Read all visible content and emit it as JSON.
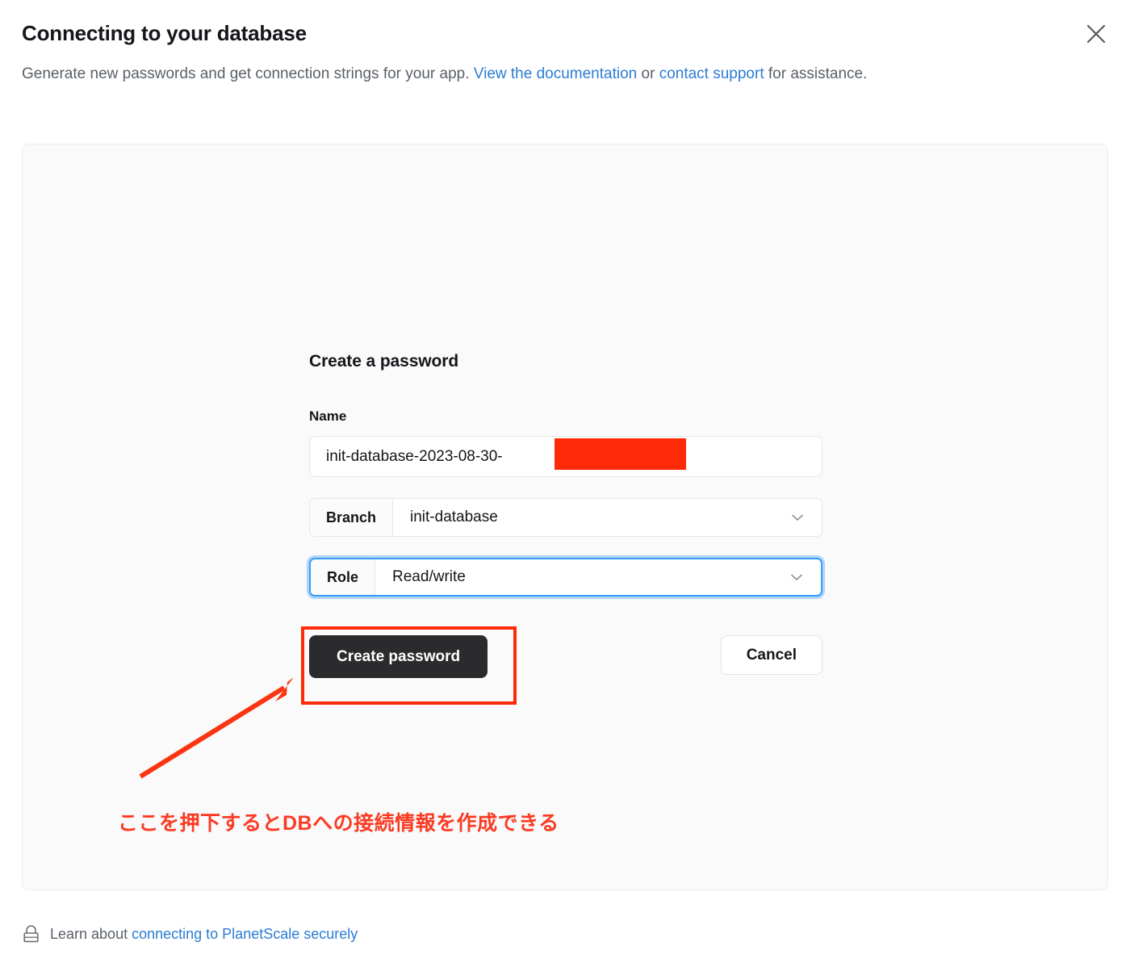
{
  "modal": {
    "title": "Connecting to your database",
    "subtitle_part1": "Generate new passwords and get connection strings for your app. ",
    "subtitle_link1": "View the documentation",
    "subtitle_part2": " or ",
    "subtitle_link2": "contact support",
    "subtitle_part3": " for assistance.",
    "close_icon": "close-icon"
  },
  "form": {
    "heading": "Create a password",
    "name_label": "Name",
    "name_value": "init-database-2023-08-30-",
    "name_redacted": true,
    "branch": {
      "prefix_label": "Branch",
      "value": "init-database",
      "chevron_icon": "chevron-down-icon"
    },
    "role": {
      "prefix_label": "Role",
      "value": "Read/write",
      "chevron_icon": "chevron-down-icon",
      "focused": true
    },
    "create_button_label": "Create password",
    "cancel_button_label": "Cancel"
  },
  "annotation": {
    "caption": "ここを押下するとDBへの接続情報を作成できる",
    "color": "#fb3b24",
    "box_color": "#fd2b0a",
    "arrow_color": "#fb3512"
  },
  "footer": {
    "lock_icon": "lock-icon",
    "text_prefix": "Learn about ",
    "link_text": "connecting to PlanetScale securely"
  },
  "colors": {
    "link_blue": "#2b7cd3",
    "focus_blue": "#3b9bf5",
    "primary_button_bg": "#2b2b2d",
    "card_bg": "#fafafa",
    "redaction_red": "#fc2a06"
  }
}
